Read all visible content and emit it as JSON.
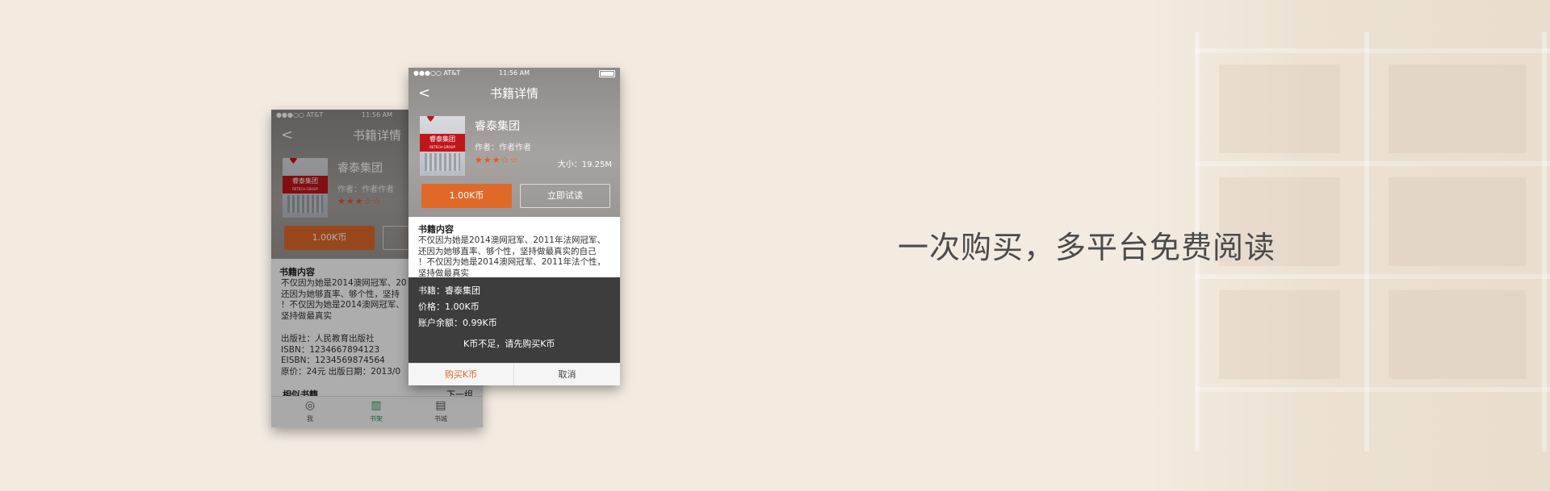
{
  "tagline": "一次购买，多平台免费阅读",
  "phone_back": {
    "status": {
      "carrier": "●●●○○ AT&T",
      "time": "11:56 AM"
    },
    "nav_title": "书籍详情",
    "back_icon": "chevron-left-icon",
    "book": {
      "title": "睿泰集团",
      "author": "作者：作者作者",
      "stars": "★★★☆☆"
    },
    "cover": {
      "brand": "睿泰集团",
      "sub": "RETECH GROUP"
    },
    "buy_label": "1.00K币",
    "section_title": "书籍内容",
    "desc_lines": [
      "不仅因为她是2014澳网冠军、20",
      "还因为她够直率、够个性，坚持",
      "！不仅因为她是2014澳网冠军、",
      "坚持做最真实"
    ],
    "meta_lines": [
      "出版社：人民教育出版社",
      "ISBN：1234667894123",
      "EISBN：1234569874564",
      "原价：24元    出版日期：2013/0"
    ],
    "similar": {
      "title": "相似书籍",
      "next": "下一组"
    },
    "tabs": [
      {
        "label": "我",
        "icon": "user-icon"
      },
      {
        "label": "书架",
        "icon": "bookshelf-icon"
      },
      {
        "label": "书城",
        "icon": "book-icon"
      }
    ]
  },
  "phone_front": {
    "status": {
      "carrier": "●●●○○ AT&T",
      "time": "11:56 AM"
    },
    "nav_title": "书籍详情",
    "back_icon": "chevron-left-icon",
    "book": {
      "title": "睿泰集团",
      "author": "作者：作者作者",
      "stars": "★★★☆☆",
      "size": "大小：19.25M"
    },
    "cover": {
      "brand": "睿泰集团",
      "sub": "RETECH GROUP"
    },
    "buy_label": "1.00K币",
    "try_label": "立即试读",
    "section_title": "书籍内容",
    "desc_lines": [
      "不仅因为她是2014澳网冠军、2011年法网冠军、",
      "还因为她够直率、够个性，坚持做最真实的自己",
      "！不仅因为她是2014澳网冠军、2011年法个性，",
      "坚持做最真实"
    ],
    "dialog": {
      "book": "书籍：睿泰集团",
      "price": "价格：1.00K币",
      "balance": "账户余额：0.99K币",
      "warning": "K币不足，请先购买K币",
      "buy": "购买K币",
      "cancel": "取消"
    }
  }
}
